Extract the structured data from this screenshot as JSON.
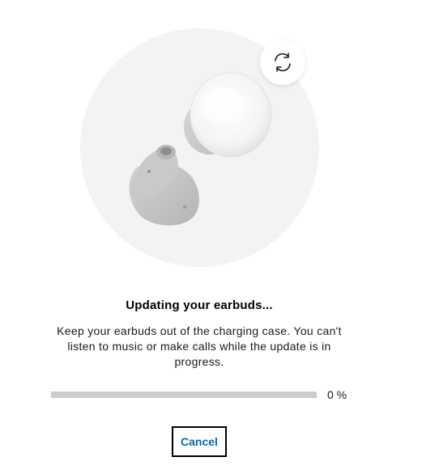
{
  "hero": {
    "image_icon": "earbuds-illustration",
    "sync_icon": "sync-icon"
  },
  "update": {
    "title": "Updating your earbuds...",
    "description": "Keep your earbuds out of the charging case. You can't listen to music or make calls while the update is in progress.",
    "progress_percent": 0,
    "progress_label": "0 %"
  },
  "actions": {
    "cancel_label": "Cancel"
  },
  "colors": {
    "accent": "#0067b8",
    "track": "#cccccc",
    "hero_background": "#f3f3f4"
  }
}
